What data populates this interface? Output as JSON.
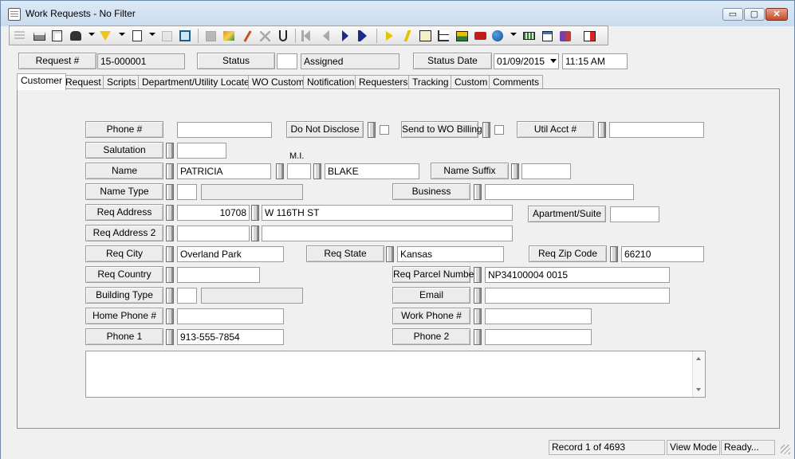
{
  "window": {
    "title": "Work Requests - No Filter",
    "min_label": "▭",
    "max_label": "▢",
    "close_label": "✕"
  },
  "header": {
    "request_num_label": "Request #",
    "request_num_value": "15-000001",
    "status_label": "Status",
    "status_code": "",
    "status_value": "Assigned",
    "status_date_label": "Status Date",
    "status_date_value": "01/09/2015",
    "status_time_value": "11:15 AM"
  },
  "tabs": [
    "Customer",
    "Request",
    "Scripts",
    "Department/Utility Locates",
    "WO Custom",
    "Notification",
    "Requesters",
    "Tracking",
    "Custom",
    "Comments"
  ],
  "form": {
    "phone_label": "Phone #",
    "phone_value": "",
    "do_not_disclose_label": "Do Not Disclose",
    "send_to_wo_billing_label": "Send to WO Billing",
    "util_acct_label": "Util Acct #",
    "util_acct_value": "",
    "salutation_label": "Salutation",
    "salutation_value": "",
    "mi_label": "M.I.",
    "name_label": "Name",
    "first_name": "PATRICIA",
    "middle_initial": "",
    "last_name": "BLAKE",
    "name_suffix_label": "Name Suffix",
    "name_suffix_value": "",
    "name_type_label": "Name Type",
    "name_type_code": "",
    "name_type_desc": "",
    "business_label": "Business",
    "business_value": "",
    "req_address_label": "Req Address",
    "address_number": "10708",
    "address_street": "W 116TH ST",
    "apartment_label": "Apartment/Suite",
    "apartment_value": "",
    "req_address2_label": "Req Address 2",
    "address2_a": "",
    "address2_b": "",
    "req_city_label": "Req City",
    "city_value": "Overland Park",
    "req_state_label": "Req State",
    "state_value": "Kansas",
    "req_zip_label": "Req Zip Code",
    "zip_value": "66210",
    "req_country_label": "Req Country",
    "country_value": "",
    "parcel_label": "Req Parcel Number",
    "parcel_value": "NP34100004 0015",
    "building_type_label": "Building Type",
    "building_type_code": "",
    "building_type_desc": "",
    "email_label": "Email",
    "email_value": "",
    "home_phone_label": "Home Phone #",
    "home_phone_value": "",
    "work_phone_label": "Work Phone #",
    "work_phone_value": "",
    "phone1_label": "Phone 1",
    "phone1_value": "913-555-7854",
    "phone2_label": "Phone 2",
    "phone2_value": "",
    "notes_value": ""
  },
  "statusbar": {
    "record": "Record 1 of 4693",
    "mode": "View Mode",
    "state": "Ready..."
  },
  "toolbar_icons": [
    "list-icon",
    "print-icon",
    "print-preview-icon",
    "binoculars-icon",
    "filter-icon",
    "report-icon",
    "copy-record-icon",
    "duplicate-icon",
    "save-icon",
    "notes-icon",
    "edit-pencil-icon",
    "delete-icon",
    "cut-icon",
    "first-record-icon",
    "previous-record-icon",
    "next-record-icon",
    "last-record-icon",
    "goto-icon",
    "lightning-icon",
    "map-icon",
    "tree-icon",
    "image-icon",
    "toolbox-icon",
    "globe-icon",
    "keyboard-icon",
    "new-window-icon",
    "book-icon",
    "exit-icon"
  ]
}
